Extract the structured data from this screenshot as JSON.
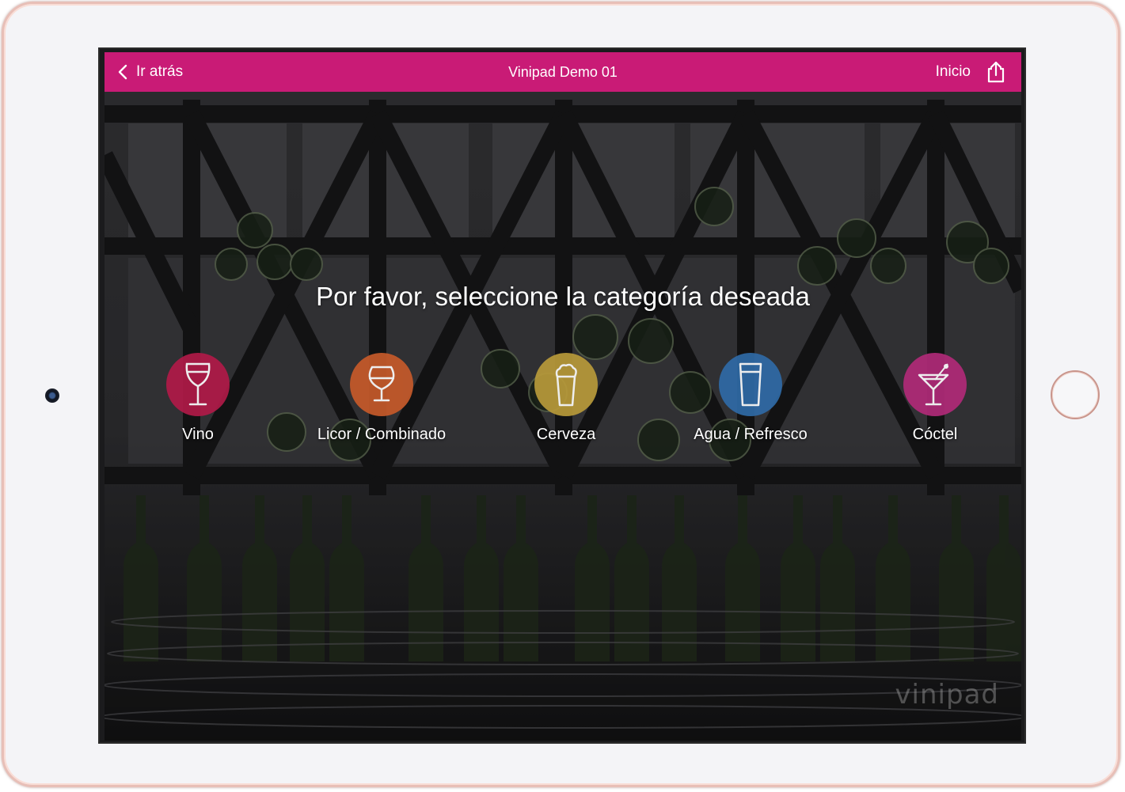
{
  "nav": {
    "back_label": "Ir atrás",
    "title": "Vinipad Demo 01",
    "home_label": "Inicio"
  },
  "prompt": "Por favor, seleccione la categoría deseada",
  "categories": [
    {
      "label": "Vino",
      "icon": "wine-glass-icon",
      "color": "#b01a48"
    },
    {
      "label": "Licor / Combinado",
      "icon": "brandy-glass-icon",
      "color": "#c65a2a"
    },
    {
      "label": "Cerveza",
      "icon": "beer-glass-icon",
      "color": "#b89a3a"
    },
    {
      "label": "Agua / Refresco",
      "icon": "water-glass-icon",
      "color": "#2f6aa6"
    },
    {
      "label": "Cóctel",
      "icon": "cocktail-glass-icon",
      "color": "#b02a78"
    }
  ],
  "watermark": "vinipad",
  "colors": {
    "nav_bar": "#c91b76"
  }
}
